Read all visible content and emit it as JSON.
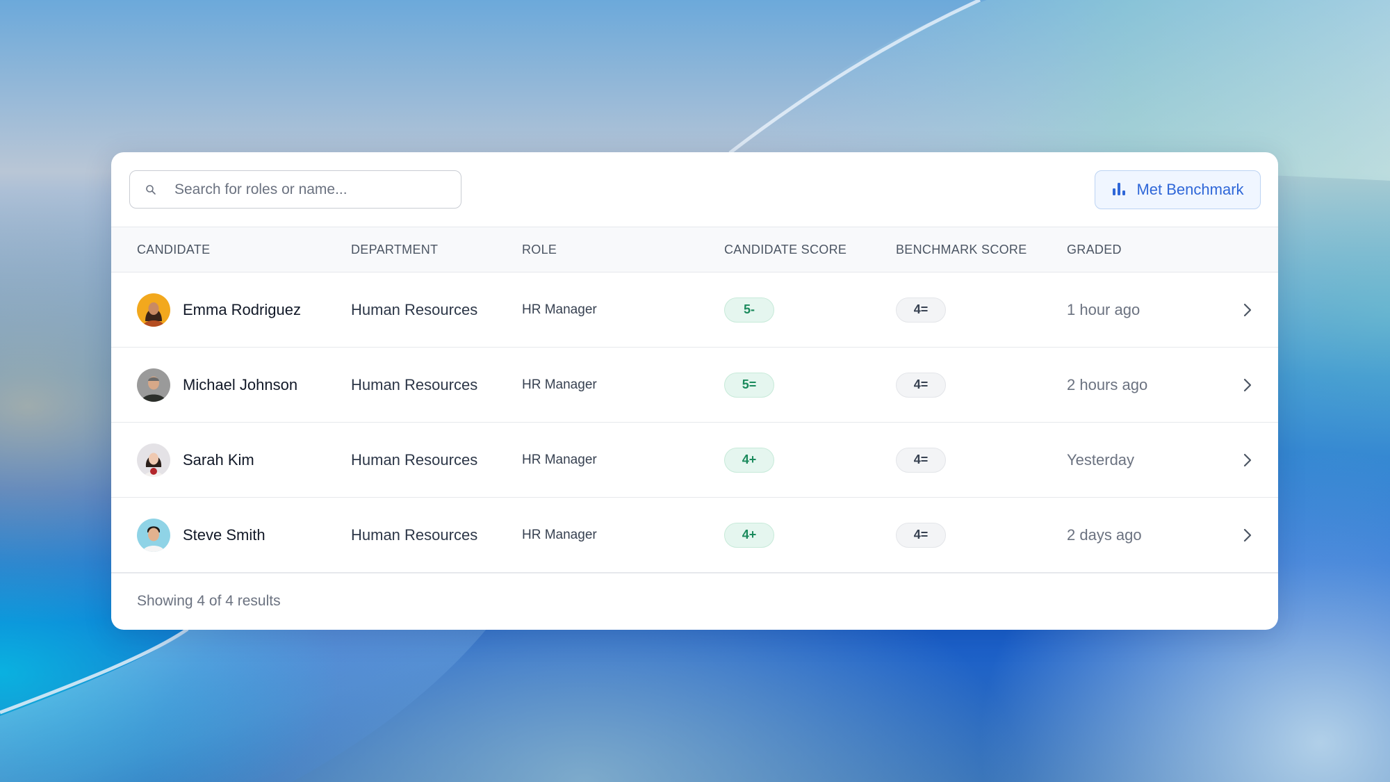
{
  "search": {
    "placeholder": "Search for roles or name..."
  },
  "toolbar": {
    "benchmark_label": "Met Benchmark",
    "benchmark_icon": "bar-chart-icon"
  },
  "table": {
    "headers": [
      "CANDIDATE",
      "DEPARTMENT",
      "ROLE",
      "CANDIDATE SCORE",
      "BENCHMARK SCORE",
      "GRADED"
    ],
    "rows": [
      {
        "name": "Emma Rodriguez",
        "department": "Human Resources",
        "role": "HR Manager",
        "candidate_score": "5-",
        "benchmark_score": "4=",
        "graded": "1 hour ago"
      },
      {
        "name": "Michael Johnson",
        "department": "Human Resources",
        "role": "HR Manager",
        "candidate_score": "5=",
        "benchmark_score": "4=",
        "graded": "2 hours ago"
      },
      {
        "name": "Sarah Kim",
        "department": "Human Resources",
        "role": "HR Manager",
        "candidate_score": "4+",
        "benchmark_score": "4=",
        "graded": "Yesterday"
      },
      {
        "name": "Steve Smith",
        "department": "Human Resources",
        "role": "HR Manager",
        "candidate_score": "4+",
        "benchmark_score": "4=",
        "graded": "2 days ago"
      }
    ]
  },
  "footer": {
    "results_text": "Showing 4 of 4 results"
  },
  "colors": {
    "accent": "#2f67d8",
    "score_green": "#1a8a5c",
    "score_green_bg": "#e5f6ef"
  }
}
